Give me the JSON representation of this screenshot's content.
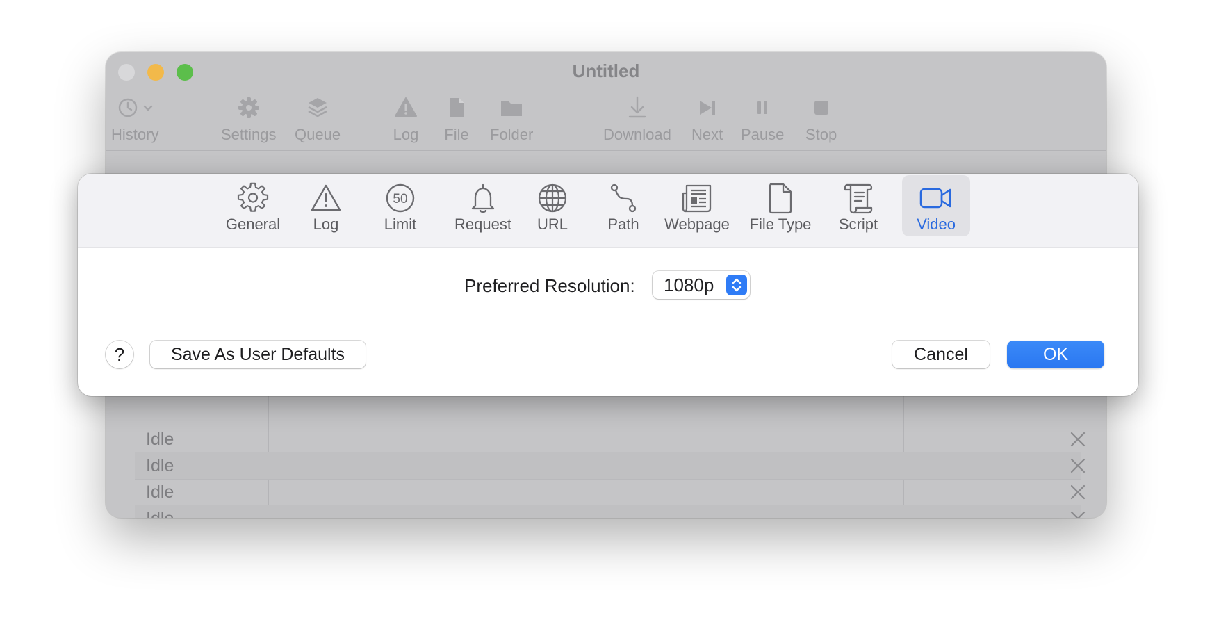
{
  "window": {
    "title": "Untitled"
  },
  "toolbar": {
    "history": "History",
    "settings": "Settings",
    "queue": "Queue",
    "log": "Log",
    "file": "File",
    "folder": "Folder",
    "download": "Download",
    "next": "Next",
    "pause": "Pause",
    "stop": "Stop"
  },
  "table": {
    "rows": [
      {
        "status": "Idle"
      },
      {
        "status": "Idle"
      },
      {
        "status": "Idle"
      },
      {
        "status": "Idle"
      }
    ]
  },
  "sheet": {
    "tabs": [
      {
        "label": "General",
        "icon": "gear-icon"
      },
      {
        "label": "Log",
        "icon": "warning-triangle-icon"
      },
      {
        "label": "Limit",
        "icon": "speed-limit-50-icon"
      },
      {
        "label": "Request",
        "icon": "bell-icon"
      },
      {
        "label": "URL",
        "icon": "globe-icon"
      },
      {
        "label": "Path",
        "icon": "path-icon"
      },
      {
        "label": "Webpage",
        "icon": "newspaper-icon"
      },
      {
        "label": "File Type",
        "icon": "document-icon"
      },
      {
        "label": "Script",
        "icon": "scroll-icon"
      },
      {
        "label": "Video",
        "icon": "video-camera-icon"
      }
    ],
    "selected_tab": "Video",
    "limit_badge": "50",
    "resolution_label": "Preferred Resolution:",
    "resolution_value": "1080p",
    "help_label": "?",
    "save_defaults_label": "Save As User Defaults",
    "cancel_label": "Cancel",
    "ok_label": "OK"
  },
  "colors": {
    "accent": "#2f7cf6",
    "selected_tab_text": "#2a6adf"
  }
}
